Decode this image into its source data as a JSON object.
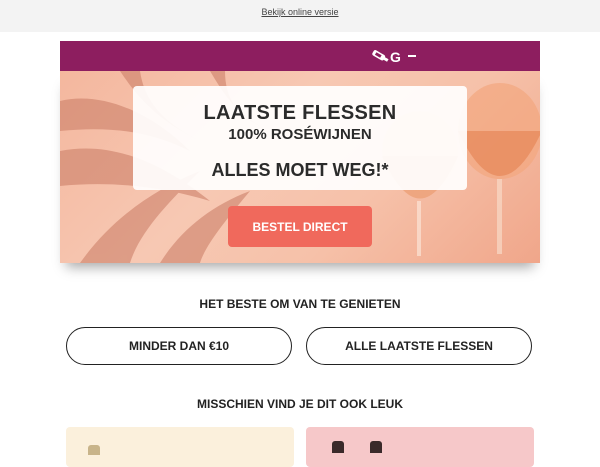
{
  "topbar": {
    "view_online": "Bekijk online versie"
  },
  "brand": {
    "logo_text": "G",
    "color": "#8d1e5f"
  },
  "hero": {
    "title": "LAATSTE FLESSEN",
    "subtitle": "100% ROSÉWIJNEN",
    "sale": "ALLES MOET WEG!*",
    "cta_label": "BESTEL DIRECT",
    "cta_color": "#f0695c"
  },
  "section1": {
    "title": "HET BESTE OM VAN TE GENIETEN",
    "buttons": [
      "MINDER DAN €10",
      "ALLE LAATSTE FLESSEN"
    ]
  },
  "section2": {
    "title": "MISSCHIEN VIND JE DIT OOK LEUK",
    "card_colors": [
      "#fbf0dc",
      "#f6c8c9"
    ]
  }
}
